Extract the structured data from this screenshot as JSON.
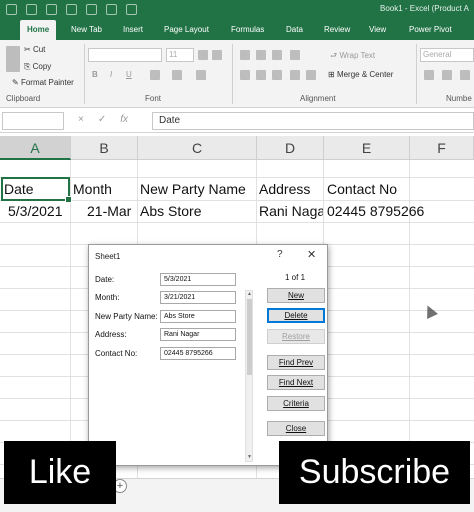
{
  "window": {
    "title": "Book1 - Excel (Product A"
  },
  "tabs": [
    "Home",
    "New Tab",
    "Insert",
    "Page Layout",
    "Formulas",
    "Data",
    "Review",
    "View",
    "Power Pivot"
  ],
  "ribbon": {
    "clipboard": {
      "cut": "Cut",
      "copy": "Copy",
      "format_painter": "Format Painter",
      "label": "Clipboard"
    },
    "font": {
      "label": "Font",
      "size": "11",
      "bold": "B",
      "italic": "I",
      "underline": "U"
    },
    "alignment": {
      "wrap_text": "Wrap Text",
      "merge_center": "Merge & Center",
      "label": "Alignment"
    },
    "number": {
      "format": "General",
      "label": "Numbe"
    }
  },
  "formula_bar": {
    "cancel": "×",
    "enter": "✓",
    "fx": "fx",
    "value": "Date"
  },
  "sheet": {
    "columns": [
      "A",
      "B",
      "C",
      "D",
      "E",
      "F"
    ],
    "header_row": [
      "Date",
      "Month",
      "New Party Name",
      "Address",
      "Contact No"
    ],
    "data_row": [
      "5/3/2021",
      "21-Mar",
      "Abs Store",
      "Rani Naga",
      "02445 8795266"
    ]
  },
  "dialog": {
    "title": "Sheet1",
    "help": "?",
    "close": "✕",
    "record_position": "1 of 1",
    "fields": [
      {
        "label": "Date:",
        "value": "5/3/2021"
      },
      {
        "label": "Month:",
        "value": "3/21/2021"
      },
      {
        "label": "New Party Name:",
        "value": "Abs Store"
      },
      {
        "label": "Address:",
        "value": "Rani Nagar"
      },
      {
        "label": "Contact No:",
        "value": "02445 8795266"
      }
    ],
    "buttons": {
      "new": "New",
      "delete": "Delete",
      "restore": "Restore",
      "find_prev": "Find Prev",
      "find_next": "Find Next",
      "criteria": "Criteria",
      "close": "Close"
    }
  },
  "sheetbar": {
    "add": "+"
  },
  "overlays": {
    "like": "Like",
    "subscribe": "Subscribe"
  },
  "colors": {
    "excel_green": "#217346",
    "overlay_black": "#000000",
    "focus_blue": "#0078d7"
  }
}
